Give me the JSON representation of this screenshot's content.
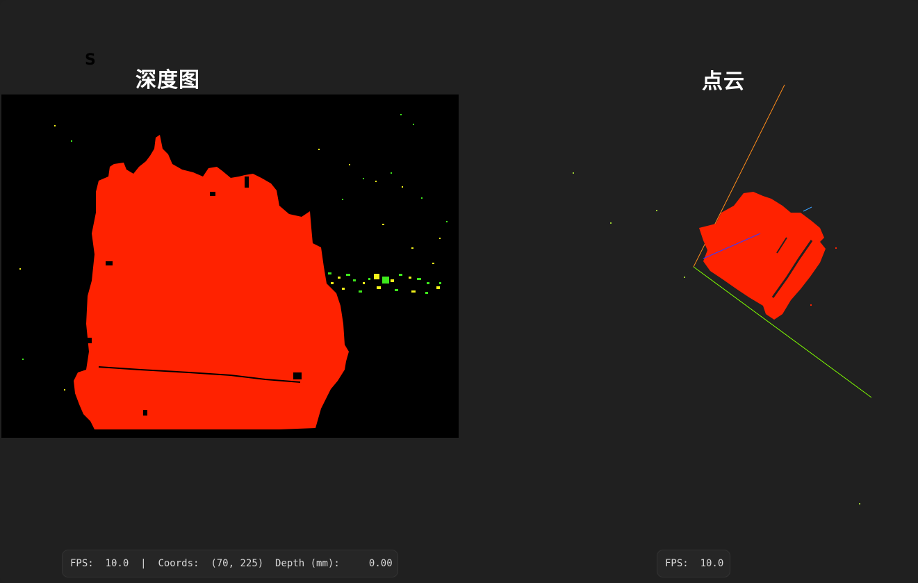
{
  "window": {
    "corner_mark": "S"
  },
  "depth_panel": {
    "title": "深度图",
    "status": {
      "fps_label": "FPS:",
      "fps_value": "10.0",
      "separator": "|",
      "coords_label": "Coords:",
      "coords_value": "(70, 225)",
      "depth_label": "Depth (mm):",
      "depth_value": "0.00"
    }
  },
  "cloud_panel": {
    "title": "点云",
    "status": {
      "fps_label": "FPS:",
      "fps_value": "10.0"
    }
  },
  "colors": {
    "background": "#202020",
    "depth_background": "#000000",
    "object": "#ff2200",
    "noise_yellow": "#f2f21a",
    "noise_green": "#3ee81c",
    "axis_x": "#ff8c1a",
    "axis_y": "#7fff00",
    "axis_z": "#3a3aff"
  }
}
